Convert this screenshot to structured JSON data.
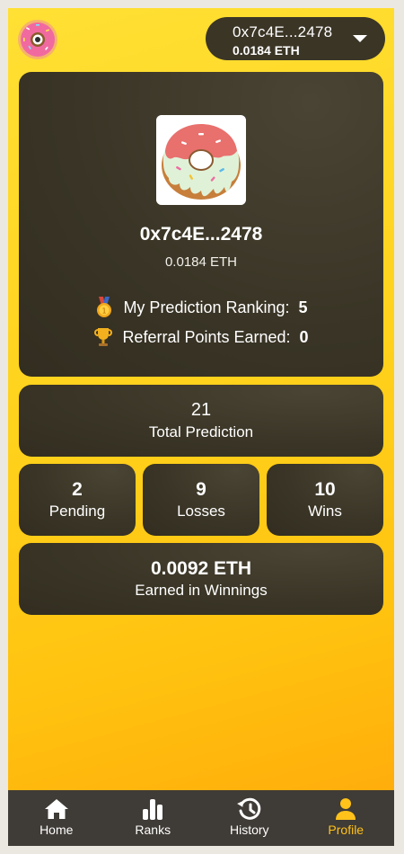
{
  "header": {
    "logo_icon": "donut-logo-icon",
    "wallet": {
      "address": "0x7c4E...2478",
      "balance": "0.0184 ETH",
      "dropdown_icon": "caret-down-icon"
    }
  },
  "profile": {
    "avatar_icon": "donut-avatar-icon",
    "address": "0x7c4E...2478",
    "balance": "0.0184 ETH",
    "ranking_label": "My Prediction Ranking:",
    "ranking_value": "5",
    "referral_label": "Referral Points Earned:",
    "referral_value": "0"
  },
  "stats": {
    "total_prediction": {
      "value": "21",
      "label": "Total Prediction"
    },
    "pending": {
      "value": "2",
      "label": "Pending"
    },
    "losses": {
      "value": "9",
      "label": "Losses"
    },
    "wins": {
      "value": "10",
      "label": "Wins"
    },
    "earned": {
      "value": "0.0092 ETH",
      "label": "Earned in Winnings"
    }
  },
  "tabbar": {
    "active": "Profile",
    "tabs": [
      {
        "label": "Home",
        "icon": "home-icon"
      },
      {
        "label": "Ranks",
        "icon": "bar-chart-icon"
      },
      {
        "label": "History",
        "icon": "history-icon"
      },
      {
        "label": "Profile",
        "icon": "user-icon"
      }
    ]
  },
  "colors": {
    "background_top": "#ffe034",
    "background_bottom": "#ffa70a",
    "card": "#3a3526",
    "tabbar": "#3f3b36",
    "active_tab": "#ffc21a"
  }
}
